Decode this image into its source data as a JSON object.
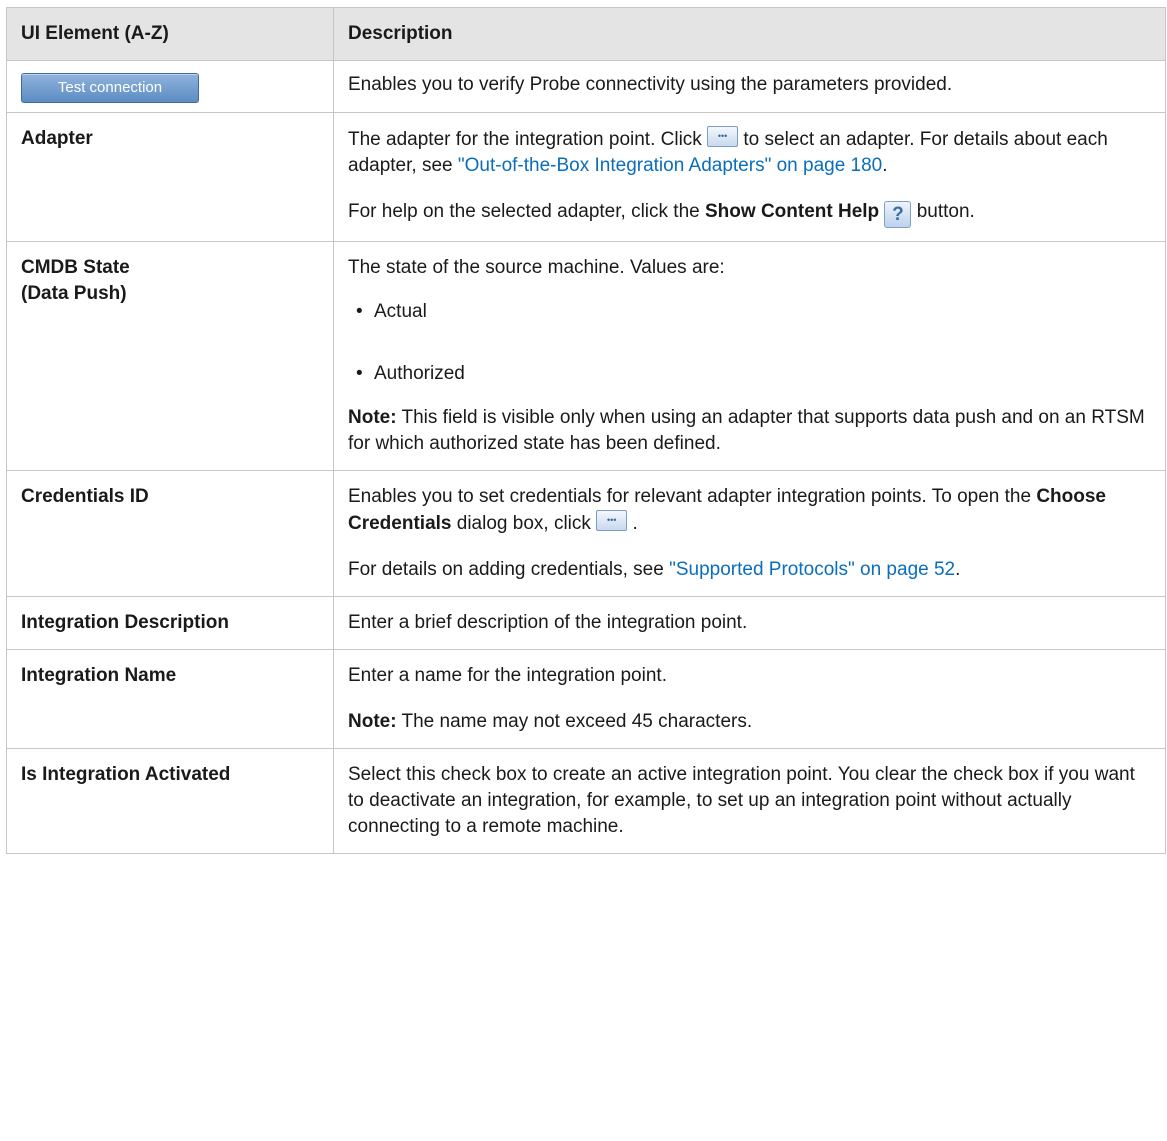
{
  "table": {
    "headers": [
      "UI Element (A-Z)",
      "Description"
    ],
    "test_connection": {
      "button_label": "Test connection",
      "description": "Enables you to verify Probe connectivity using the parameters provided."
    },
    "adapter": {
      "name": "Adapter",
      "p1_before": "The adapter for the integration point. Click",
      "p1_middle": "to select an adapter. For details about each adapter, see",
      "p1_link": "\"Out-of-the-Box Integration Adapters\" on page 180",
      "p1_end": ".",
      "p2_before": "For help on the selected adapter, click the",
      "p2_bold": "Show Content Help",
      "p2_after": "button.",
      "browse_icon": "ellipsis-browse-icon",
      "help_icon": "question-mark-help-icon"
    },
    "cmdb_state": {
      "name_line1": "CMDB State",
      "name_line2": "(Data Push)",
      "intro": "The state of the source machine. Values are:",
      "values": [
        "Actual",
        "Authorized"
      ],
      "note_label": "Note:",
      "note_text": "This field is visible only when using an adapter that supports data push and on an RTSM for which authorized state has been defined."
    },
    "credentials_id": {
      "name": "Credentials ID",
      "p1_before": "Enables you to set credentials for relevant adapter integration points. To open the",
      "p1_bold": "Choose Credentials",
      "p1_after": "dialog box, click",
      "p1_end": ".",
      "p2_before": "For details on adding credentials, see",
      "p2_link": "\"Supported Protocols\" on page 52",
      "p2_end": ".",
      "browse_icon": "ellipsis-browse-icon"
    },
    "integration_description": {
      "name": "Integration Description",
      "description": "Enter a brief description of the integration point."
    },
    "integration_name": {
      "name": "Integration Name",
      "description": "Enter a name for the integration point.",
      "note_label": "Note:",
      "note_text": "The name may not exceed 45 characters."
    },
    "is_integration_activated": {
      "name": "Is Integration Activated",
      "description": "Select this check box to create an active integration point. You clear the check box if you want to deactivate an integration, for example, to set up an integration point without actually connecting to a remote machine."
    }
  }
}
